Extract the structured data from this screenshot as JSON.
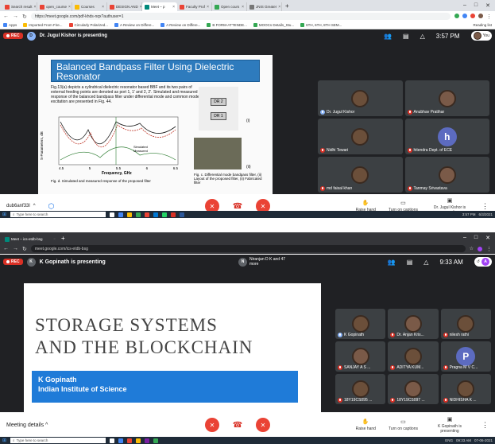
{
  "top": {
    "tabs": [
      {
        "label": "Search result",
        "color": "#ea4335"
      },
      {
        "label": "open_course",
        "color": "#ea4335"
      },
      {
        "label": "Courses",
        "color": "#fbbc04"
      },
      {
        "label": "DESIGN AND",
        "color": "#ea4335"
      },
      {
        "label": "Meet – p",
        "color": "#00897b",
        "active": true
      },
      {
        "label": "Faculty Prof",
        "color": "#ea4335"
      },
      {
        "label": "Open cours",
        "color": "#34a853"
      },
      {
        "label": "JNIS Greater",
        "color": "#777"
      }
    ],
    "url": "https://meet.google.com/pdf-khds-nqx?authuser=1",
    "bookmarks": [
      {
        "label": "Apps",
        "color": "#4285f4"
      },
      {
        "label": "Imported From Fire...",
        "color": "#fbbc04"
      },
      {
        "label": "Circularly Polarized...",
        "color": "#ea4335"
      },
      {
        "label": "A Review on Differe...",
        "color": "#4285f4"
      },
      {
        "label": "A Review on Differe...",
        "color": "#4285f4"
      },
      {
        "label": "B FORM-ATTENDE...",
        "color": "#34a853"
      },
      {
        "label": "MOOCs Details_Stu...",
        "color": "#34a853"
      },
      {
        "label": "6TH, 6TH, 8TH SEM...",
        "color": "#34a853"
      }
    ],
    "reading_list": "Reading list",
    "rec": "REC",
    "presenter_initial": "D",
    "presenter": "Dr. Jugul Kishor is presenting",
    "time": "3:57 PM",
    "you": "You",
    "slide": {
      "title": "Balanced Bandpass Filter Using Dielectric Resonator",
      "body": "Fig.13(a) depicts a cylindrical dielectric resonator based BBF and its two pairs of external feeding points are denoted as port 1, 1' and 2, 2'. Simulated and measured response of the balanced bandpass filter under differential mode and common mode excitation are presented in Fig. 44.",
      "y_axis": "S-Parameters, dB",
      "x_axis": "Frequency, GHz",
      "x_ticks": [
        "4.5",
        "5",
        "5.5",
        "6",
        "6.5"
      ],
      "legend": [
        "Simulated",
        "Measured"
      ],
      "caption_left": "Fig. d. Simulated and measured response of the proposed filter",
      "caption_right": "Fig. c. Differential mode bandpass filter, (ii) Layout of the proposed filter, (ii) Fabricated filter",
      "marker_i": "(i)",
      "marker_ii": "(ii)",
      "label_dr2": "DR 2",
      "label_dr1": "DR 1"
    },
    "participants": [
      {
        "name": "Dr. Jugul Kishor",
        "type": "photo"
      },
      {
        "name": "Anubhav Pratihar",
        "type": "photo"
      },
      {
        "name": "Nidhi Tewari",
        "type": "photo"
      },
      {
        "name": "hitendra Dept. of ECE",
        "type": "letter",
        "letter": "h"
      },
      {
        "name": "md faisal khan",
        "type": "photo"
      },
      {
        "name": "Tanmay Srivastava",
        "type": "photo"
      }
    ],
    "meeting_code": "dub6anf33l",
    "controls": {
      "raise_hand": "Raise hand",
      "captions": "Turn on captions",
      "presenting": "Dr. Jugul Kishor is presenting"
    },
    "taskbar": {
      "search": "Type here to search",
      "time": "3:57 PM",
      "date": "6/3/2021"
    }
  },
  "bottom": {
    "tabs": [
      {
        "label": "Meet – ics-etdb-bsg",
        "color": "#00897b",
        "active": true
      }
    ],
    "url": "meet.google.com/ics-etdb-bsg",
    "rec": "REC",
    "presenter_initial": "K",
    "presenter": "K Gopinath is presenting",
    "joined_initial": "N",
    "joined": "Niranjan D K and 47 more",
    "time": "9:33 AM",
    "you_initial": "A",
    "slide": {
      "line1": "STORAGE SYSTEMS",
      "line2": "AND THE BLOCKCHAIN",
      "name": "K Gopinath",
      "org": "Indian Institute of Science"
    },
    "participants": [
      {
        "name": "K Gopinath",
        "type": "photo"
      },
      {
        "name": "Dr. Anjan Kris...",
        "type": "photo"
      },
      {
        "name": "nilesh rathi",
        "type": "photo"
      },
      {
        "name": "SANJAY A S ...",
        "type": "photo"
      },
      {
        "name": "ADITYA KUM...",
        "type": "photo"
      },
      {
        "name": "Pragna M V C...",
        "type": "letter",
        "letter": "P"
      },
      {
        "name": "18Y19CS095 ...",
        "type": "photo"
      },
      {
        "name": "18Y19CS097 ...",
        "type": "photo"
      },
      {
        "name": "NIDHISHA K ...",
        "type": "photo"
      }
    ],
    "meeting_details": "Meeting details",
    "controls": {
      "raise_hand": "Raise hand",
      "captions": "Turn on captions",
      "presenting": "K Gopinath is presenting"
    },
    "taskbar": {
      "search": "Type here to search",
      "lang": "ENG",
      "time": "09:33 AM",
      "date": "07-06-2021"
    }
  }
}
